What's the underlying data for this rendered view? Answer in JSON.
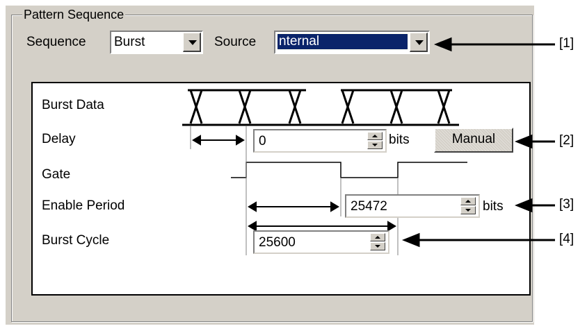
{
  "group": {
    "title": "Pattern Sequence"
  },
  "sequence": {
    "label": "Sequence",
    "value": "Burst"
  },
  "source": {
    "label": "Source",
    "value": "nternal"
  },
  "timing": {
    "burst_data_label": "Burst Data",
    "delay_label": "Delay",
    "gate_label": "Gate",
    "enable_period_label": "Enable Period",
    "burst_cycle_label": "Burst Cycle"
  },
  "delay": {
    "value": "0",
    "unit": "bits",
    "mode_button": "Manual"
  },
  "enable_period": {
    "value": "25472",
    "unit": "bits"
  },
  "burst_cycle": {
    "value": "25600"
  },
  "callouts": [
    "[1]",
    "[2]",
    "[3]",
    "[4]"
  ]
}
